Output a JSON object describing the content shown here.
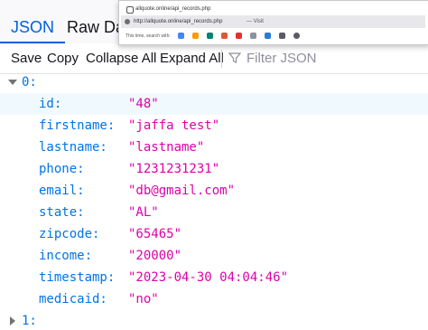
{
  "tabs": [
    {
      "label": "JSON",
      "active": true
    },
    {
      "label": "Raw Data",
      "active": false
    }
  ],
  "toolbar": {
    "save": "Save",
    "copy": "Copy",
    "collapse_all": "Collapse All",
    "expand_all": "Expand All",
    "filter_placeholder": "Filter JSON"
  },
  "tree": {
    "first_index": "0:",
    "properties": [
      {
        "key": "id:",
        "value": "\"48\""
      },
      {
        "key": "firstname:",
        "value": "\"jaffa test\""
      },
      {
        "key": "lastname:",
        "value": "\"lastname\""
      },
      {
        "key": "phone:",
        "value": "\"1231231231\""
      },
      {
        "key": "email:",
        "value": "\"db@gmail.com\""
      },
      {
        "key": "state:",
        "value": "\"AL\""
      },
      {
        "key": "zipcode:",
        "value": "\"65465\""
      },
      {
        "key": "income:",
        "value": "\"20000\""
      },
      {
        "key": "timestamp:",
        "value": "\"2023-04-30 04:04:46\""
      },
      {
        "key": "medicaid:",
        "value": "\"no\""
      }
    ],
    "next_index": "1:"
  },
  "popup": {
    "url_input": "allquote.online/api_records.php",
    "suggestion_url": "http://allquote.online/api_records.php",
    "suggestion_action": "— Visit",
    "search_with_label": "This time, search with:"
  },
  "colors": {
    "accent": "#0060df",
    "json_key": "#0074e8",
    "json_string": "#dd00a9"
  }
}
